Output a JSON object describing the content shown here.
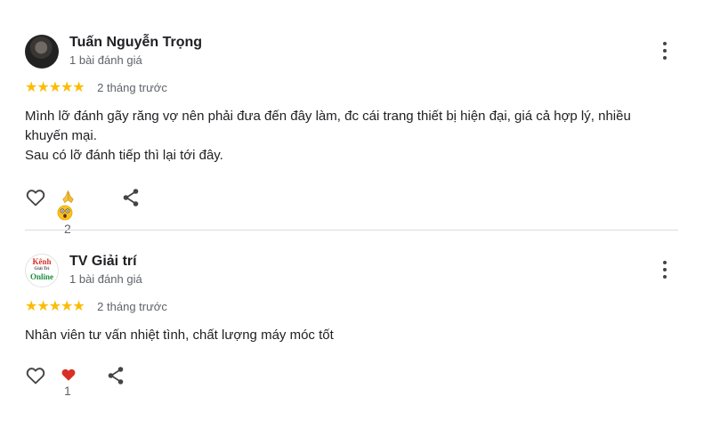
{
  "reviews": [
    {
      "author": "Tuấn Nguyễn Trọng",
      "meta": "1 bài đánh giá",
      "stars": "★★★★★",
      "rating": 5,
      "date": "2 tháng trước",
      "text_lines": [
        "Mình lỡ đánh gãy răng vợ nên phải đưa đến đây làm, đc cái trang thiết bị hiện đại, giá cả hợp lý, nhiều",
        "khuyến mại.",
        "Sau có lỡ đánh tiếp thì lại tới đây."
      ],
      "reactions": {
        "emoji": [
          "praying-hands-emoji",
          "astonished-face-emoji"
        ],
        "count": "2"
      },
      "icons": [
        "heart-outline-icon",
        "share-icon",
        "more-vertical-icon"
      ]
    },
    {
      "author": "TV Giải trí",
      "avatar_logo": {
        "top": "Kênh",
        "mid": "Giải Trí",
        "bottom": "Online"
      },
      "meta": "1 bài đánh giá",
      "stars": "★★★★★",
      "rating": 5,
      "date": "2 tháng trước",
      "text_lines": [
        "Nhân viên tư vấn nhiệt tình, chất lượng máy móc tốt"
      ],
      "reactions": {
        "emoji": [
          "red-heart-emoji"
        ],
        "count": "1"
      },
      "icons": [
        "heart-outline-icon",
        "share-icon",
        "more-vertical-icon"
      ]
    }
  ],
  "colors": {
    "star": "#fbbc04",
    "text": "#202124",
    "secondary": "#5f6368",
    "divider": "#dadce0",
    "heart": "#d93025"
  }
}
